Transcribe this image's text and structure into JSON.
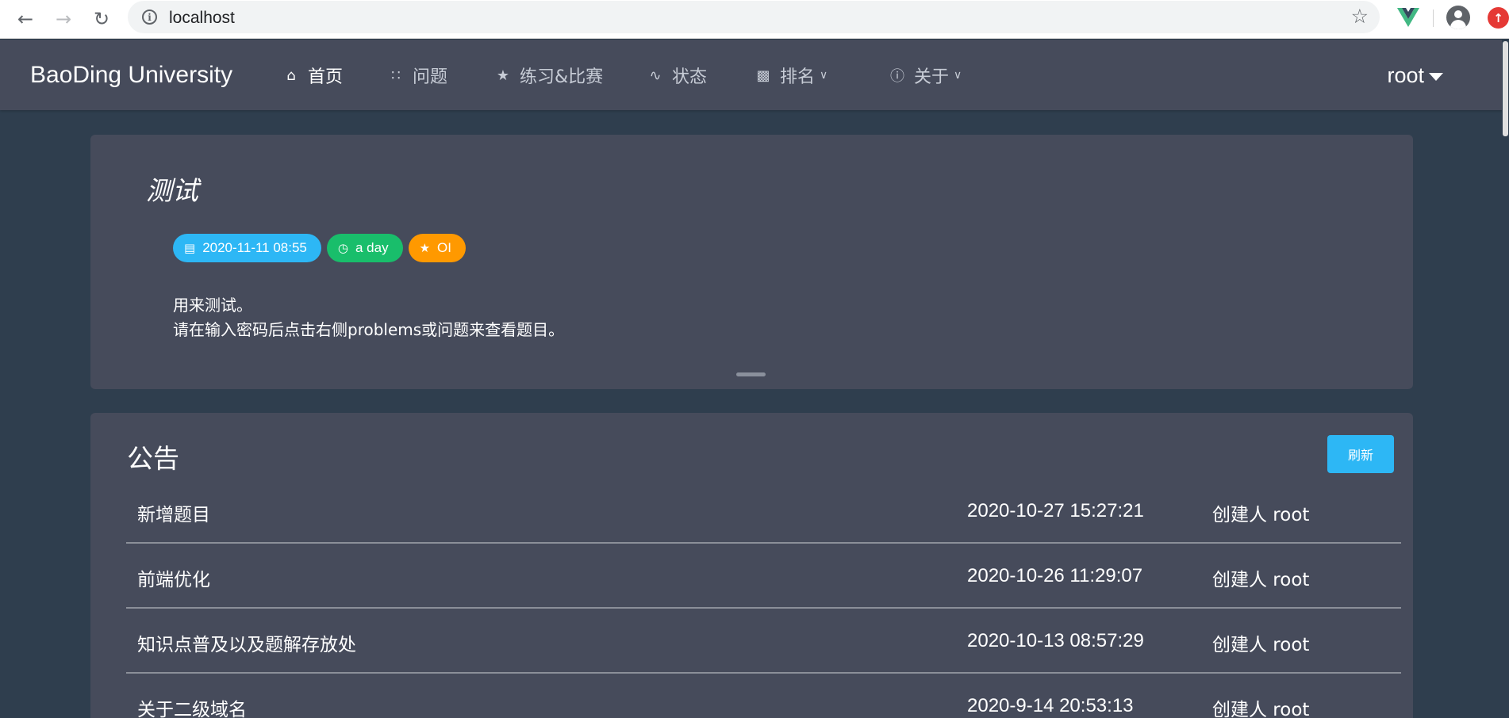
{
  "browser": {
    "url": "localhost",
    "back_icon": "arrow-left-icon",
    "forward_icon": "arrow-right-icon",
    "reload_icon": "reload-icon",
    "info_icon": "info-icon",
    "star_icon": "star-icon",
    "extension_icon": "vue-devtools-icon",
    "profile_icon": "profile-icon",
    "update_icon": "update-icon"
  },
  "navbar": {
    "brand": "BaoDing University",
    "items": [
      {
        "label": "首页",
        "icon": "home-icon",
        "active": true
      },
      {
        "label": "问题",
        "icon": "grid-icon"
      },
      {
        "label": "练习&比赛",
        "icon": "trophy-icon"
      },
      {
        "label": "状态",
        "icon": "pulse-icon"
      },
      {
        "label": "排名",
        "icon": "bar-chart-icon",
        "dropdown": true
      },
      {
        "label": "关于",
        "icon": "info-circle-icon",
        "dropdown": true
      }
    ],
    "user": "root"
  },
  "contest": {
    "title": "测试",
    "start_time": "2020-11-11 08:55",
    "duration": "a day",
    "rule_type": "OI",
    "description_lines": [
      "用来测试。",
      "请在输入密码后点击右侧problems或问题来查看题目。"
    ]
  },
  "announcements": {
    "title": "公告",
    "refresh_label": "刷新",
    "rows": [
      {
        "title": "新增题目",
        "time": "2020-10-27 15:27:21",
        "creator": "创建人 root"
      },
      {
        "title": "前端优化",
        "time": "2020-10-26 11:29:07",
        "creator": "创建人 root"
      },
      {
        "title": "知识点普及以及题解存放处",
        "time": "2020-10-13 08:57:29",
        "creator": "创建人 root"
      },
      {
        "title": "关于二级域名",
        "time": "2020-9-14 20:53:13",
        "creator": "创建人 root"
      }
    ]
  },
  "colors": {
    "page_bg": "#2f3e4e",
    "card_bg": "#464b5b",
    "tag_blue": "#2db7f5",
    "tag_green": "#19be6b",
    "tag_orange": "#ff9900"
  }
}
